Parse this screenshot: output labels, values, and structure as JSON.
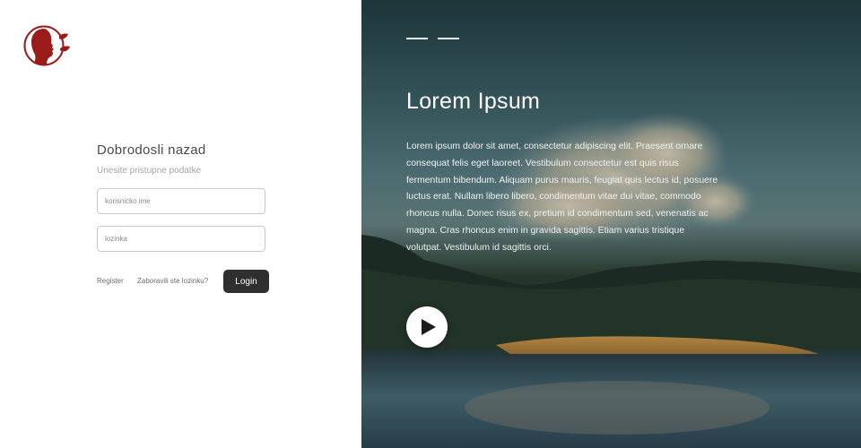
{
  "brand": {
    "logo_icon": "face-leaf-logo-icon",
    "logo_color": "#9b1b1b"
  },
  "login": {
    "title": "Dobrodosli nazad",
    "subtitle": "Unesite pristupne podatke",
    "username_placeholder": "korisnicko ime",
    "password_placeholder": "lozinka",
    "register_link": "Register",
    "forgot_link": "Zaboravili ste lozinku?",
    "login_button": "Login",
    "button_color": "#2f2f2f"
  },
  "hero": {
    "slide_count": 2,
    "title": "Lorem Ipsum",
    "text": "Lorem ipsum dolor sit amet, consectetur adipiscing elit. Praesent ornare consequat felis eget laoreet. Vestibulum consectetur est quis risus fermentum bibendum. Aliquam purus mauris, feugiat quis lectus id, posuere luctus erat. Nullam libero libero, condimentum vitae dui vitae, commodo rhoncus nulla. Donec risus ex, pretium id condimentum sed, venenatis ac magna. Cras rhoncus enim in gravida sagittis. Etiam varius tristique volutpat. Vestibulum id sagittis orci.",
    "play_icon": "play-icon"
  }
}
